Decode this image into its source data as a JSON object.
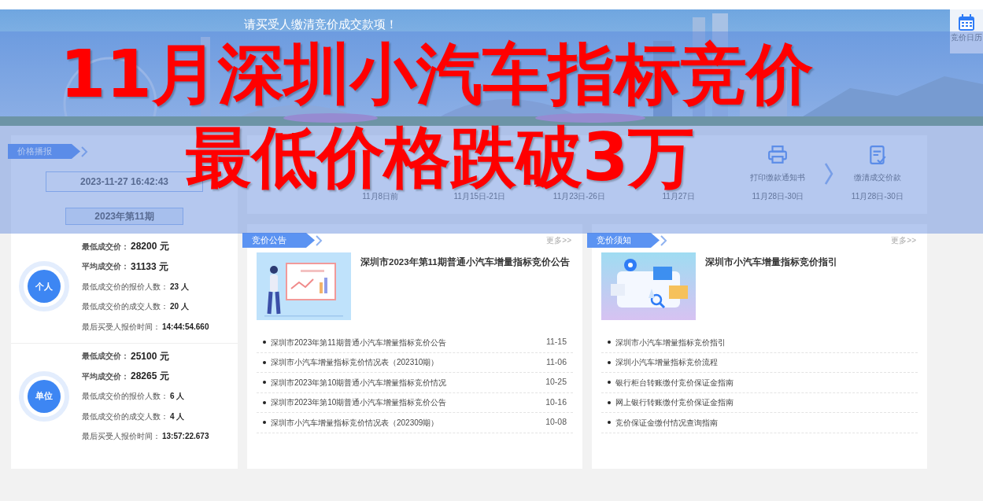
{
  "banner": {
    "notice": "请买受人缴清竞价成交款项！"
  },
  "calendar_button": {
    "label": "竞价日历"
  },
  "headline": {
    "lines": [
      "11月深圳小汽车指标竞价",
      "最低价格跌破3万"
    ]
  },
  "price_report": {
    "tab": "价格播报",
    "timestamp": "2023-11-27 16:42:43",
    "period": "2023年第11期",
    "groups": [
      {
        "badge": "个人",
        "rows": [
          {
            "kind": "price",
            "label": "最低成交价：",
            "value": "28200 元"
          },
          {
            "kind": "price",
            "label": "平均成交价：",
            "value": "31133 元"
          },
          {
            "kind": "stat",
            "label": "最低成交价的报价人数：",
            "value": "23 人"
          },
          {
            "kind": "stat",
            "label": "最低成交价的成交人数：",
            "value": "20 人"
          },
          {
            "kind": "stat",
            "label": "最后买受人报价时间：",
            "value": "14:44:54.660"
          }
        ]
      },
      {
        "badge": "单位",
        "rows": [
          {
            "kind": "price",
            "label": "最低成交价：",
            "value": "25100 元"
          },
          {
            "kind": "price",
            "label": "平均成交价：",
            "value": "28265 元"
          },
          {
            "kind": "stat",
            "label": "最低成交价的报价人数：",
            "value": "6 人"
          },
          {
            "kind": "stat",
            "label": "最低成交价的成交人数：",
            "value": "4 人"
          },
          {
            "kind": "stat",
            "label": "最后买受人报价时间：",
            "value": "13:57:22.673"
          }
        ]
      }
    ]
  },
  "process": {
    "steps": [
      {
        "date": "11月8日前"
      },
      {
        "date": "11月15日-21日"
      },
      {
        "date": "11月23日-26日"
      },
      {
        "date": "11月27日"
      },
      {
        "label": "打印缴款通知书",
        "date": "11月28日-30日"
      },
      {
        "label": "缴清成交价款",
        "date": "11月28日-30日"
      }
    ]
  },
  "announcements": {
    "tab": "竞价公告",
    "more": "更多>>",
    "feature_title": "深圳市2023年第11期普通小汽车增量指标竞价公告",
    "items": [
      {
        "title": "深圳市2023年第11期普通小汽车增量指标竞价公告",
        "date": "11-15"
      },
      {
        "title": "深圳市小汽车增量指标竞价情况表（202310期）",
        "date": "11-06"
      },
      {
        "title": "深圳市2023年第10期普通小汽车增量指标竞价情况",
        "date": "10-25"
      },
      {
        "title": "深圳市2023年第10期普通小汽车增量指标竞价公告",
        "date": "10-16"
      },
      {
        "title": "深圳市小汽车增量指标竞价情况表（202309期）",
        "date": "10-08"
      }
    ]
  },
  "notices": {
    "tab": "竞价须知",
    "more": "更多>>",
    "feature_title": "深圳市小汽车增量指标竞价指引",
    "items": [
      {
        "title": "深圳市小汽车增量指标竞价指引"
      },
      {
        "title": "深圳小汽车增量指标竞价流程"
      },
      {
        "title": "银行柜台转账缴付竞价保证金指南"
      },
      {
        "title": "网上银行转账缴付竞价保证金指南"
      },
      {
        "title": "竞价保证金缴付情况查询指南"
      }
    ]
  }
}
